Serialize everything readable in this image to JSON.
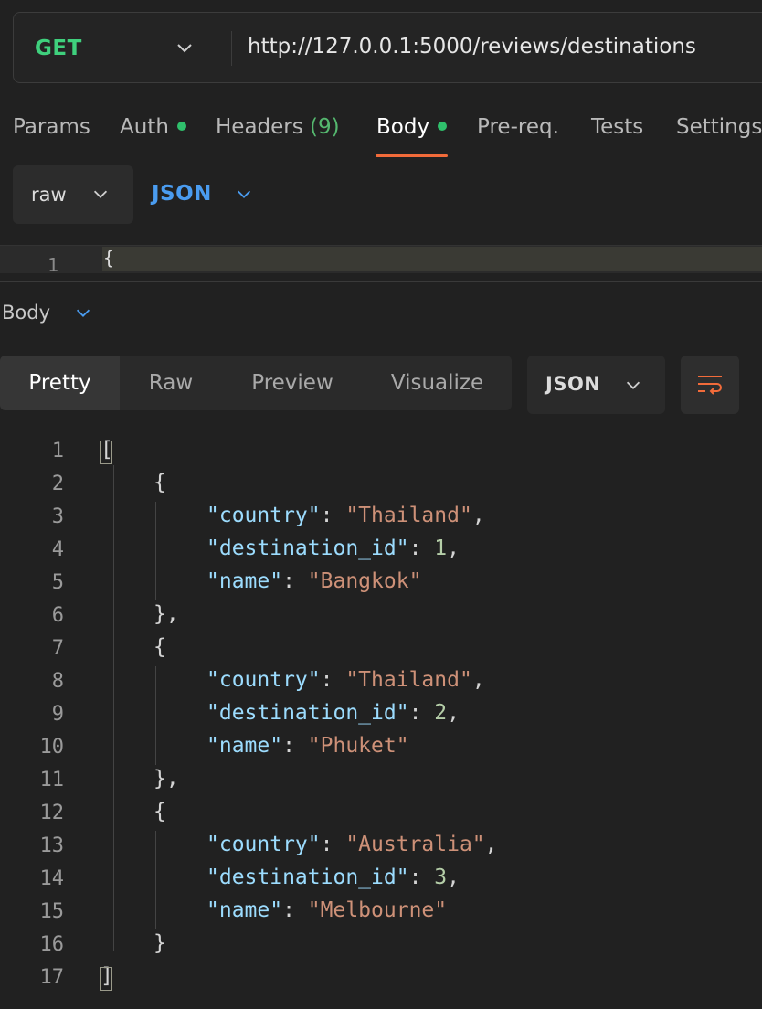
{
  "request": {
    "method": "GET",
    "url": "http://127.0.0.1:5000/reviews/destinations"
  },
  "request_tabs": [
    {
      "label": "Params"
    },
    {
      "label": "Auth",
      "dot": true
    },
    {
      "label": "Headers",
      "count": "(9)"
    },
    {
      "label": "Body",
      "dot": true,
      "active": true
    },
    {
      "label": "Pre-req."
    },
    {
      "label": "Tests"
    },
    {
      "label": "Settings"
    }
  ],
  "body_options": {
    "mode": "raw",
    "language": "JSON"
  },
  "request_editor": {
    "line_number": "1",
    "content": "{"
  },
  "response": {
    "section_label": "Body",
    "view_tabs": [
      "Pretty",
      "Raw",
      "Preview",
      "Visualize"
    ],
    "active_view": "Pretty",
    "format": "JSON",
    "records": [
      {
        "country": "Thailand",
        "destination_id": 1,
        "name": "Bangkok"
      },
      {
        "country": "Thailand",
        "destination_id": 2,
        "name": "Phuket"
      },
      {
        "country": "Australia",
        "destination_id": 3,
        "name": "Melbourne"
      }
    ],
    "line_numbers": [
      "1",
      "2",
      "3",
      "4",
      "5",
      "6",
      "7",
      "8",
      "9",
      "10",
      "11",
      "12",
      "13",
      "14",
      "15",
      "16",
      "17"
    ]
  },
  "colors": {
    "method": "#3fd07d",
    "accent_underline": "#f26b3a",
    "json_label": "#4a9cf0",
    "key": "#9cdcfe",
    "string": "#ce9178",
    "number": "#b5cea8"
  },
  "icons": {
    "method_dropdown": "chevron-down-icon",
    "wrap": "wrap-lines-icon"
  }
}
